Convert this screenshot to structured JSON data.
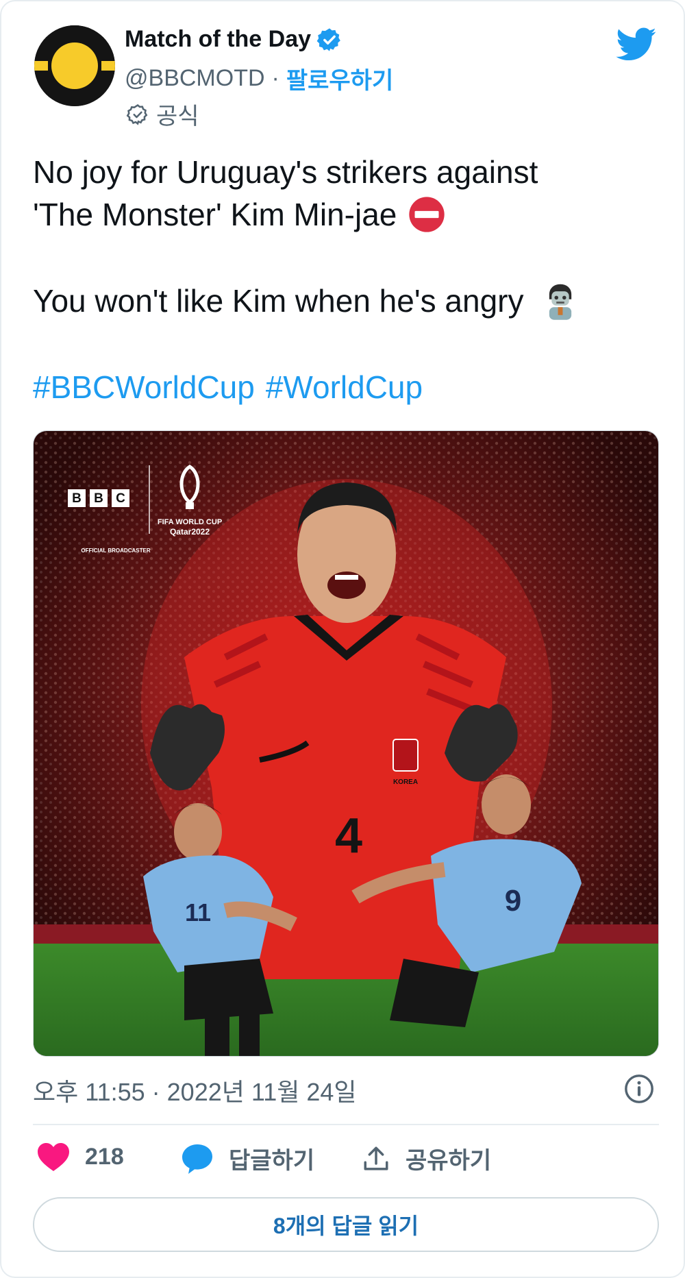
{
  "author": {
    "name": "Match of the Day",
    "handle": "@BBCMOTD",
    "follow_label": "팔로우하기",
    "official_label": "공식"
  },
  "tweet": {
    "line1": "No joy for Uruguay's strikers against",
    "line2": "'The Monster' Kim Min-jae",
    "line3": "You won't like Kim when he's angry",
    "hashtag1": "#BBCWorldCup",
    "hashtag2": "#WorldCup"
  },
  "media": {
    "broadcaster_logo": "BBC",
    "tournament_line1": "FIFA WORLD CUP",
    "tournament_line2": "Qatar2022",
    "official_broadcaster": "OFFICIAL BROADCASTER",
    "team_label": "KOREA",
    "main_number": "4",
    "left_number": "11",
    "right_number": "9"
  },
  "timestamp": "오후 11:55 · 2022년 11월 24일",
  "actions": {
    "like_count": "218",
    "reply_label": "답글하기",
    "share_label": "공유하기"
  },
  "read_replies_label": "8개의 답글 읽기",
  "colors": {
    "accent": "#1d9bf0",
    "like": "#f91880",
    "text_secondary": "#536471"
  },
  "icons": [
    "avatar",
    "verified-icon",
    "official-check-icon",
    "twitter-bird-icon",
    "no-entry-emoji-icon",
    "zombie-emoji-icon",
    "info-icon",
    "heart-icon",
    "reply-bubble-icon",
    "share-icon"
  ]
}
